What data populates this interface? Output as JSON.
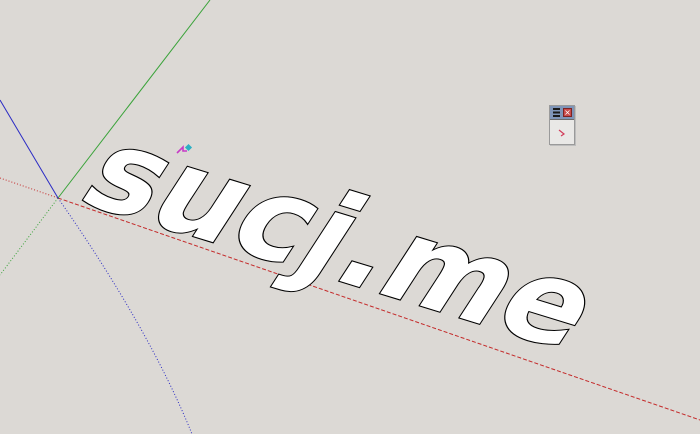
{
  "scene": {
    "model_text": "sucj.me",
    "axis_colors": {
      "red": "#c42a2a",
      "green": "#3aa33a",
      "blue": "#2b2bc4"
    },
    "text_fill": "#ffffff",
    "text_outline": "#000000",
    "background": "#dcd9d5"
  },
  "toolbar": {
    "grip_icon": "grip-icon",
    "close_icon": "close-icon",
    "close_glyph": "×",
    "tool_icon": "arrow-tool-icon",
    "accent": "#7f95b8"
  },
  "cursor": {
    "icon": "move-cursor-icon",
    "colors": [
      "#c63bc6",
      "#2bb0c4"
    ]
  }
}
